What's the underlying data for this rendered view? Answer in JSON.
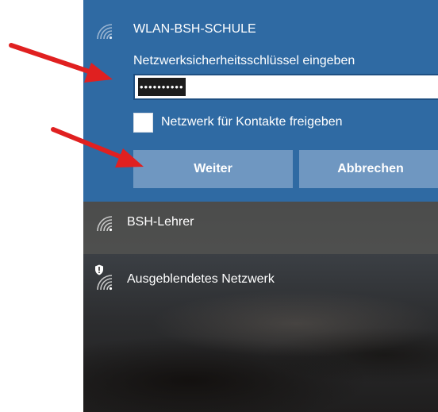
{
  "active_network": {
    "ssid": "WLAN-BSH-SCHULE",
    "prompt": "Netzwerksicherheitsschlüssel eingeben",
    "password_masked": "••••••••••",
    "share_label": "Netzwerk für Kontakte freigeben",
    "share_checked": false,
    "next_button": "Weiter",
    "cancel_button": "Abbrechen"
  },
  "networks": [
    {
      "ssid": "BSH-Lehrer",
      "icon": "wifi-icon"
    },
    {
      "ssid": "Ausgeblendetes Netzwerk",
      "icon": "wifi-shield-icon"
    }
  ],
  "colors": {
    "accent": "#2f6aa3",
    "button": "#6f97c1",
    "annotation_arrow": "#e02020"
  }
}
